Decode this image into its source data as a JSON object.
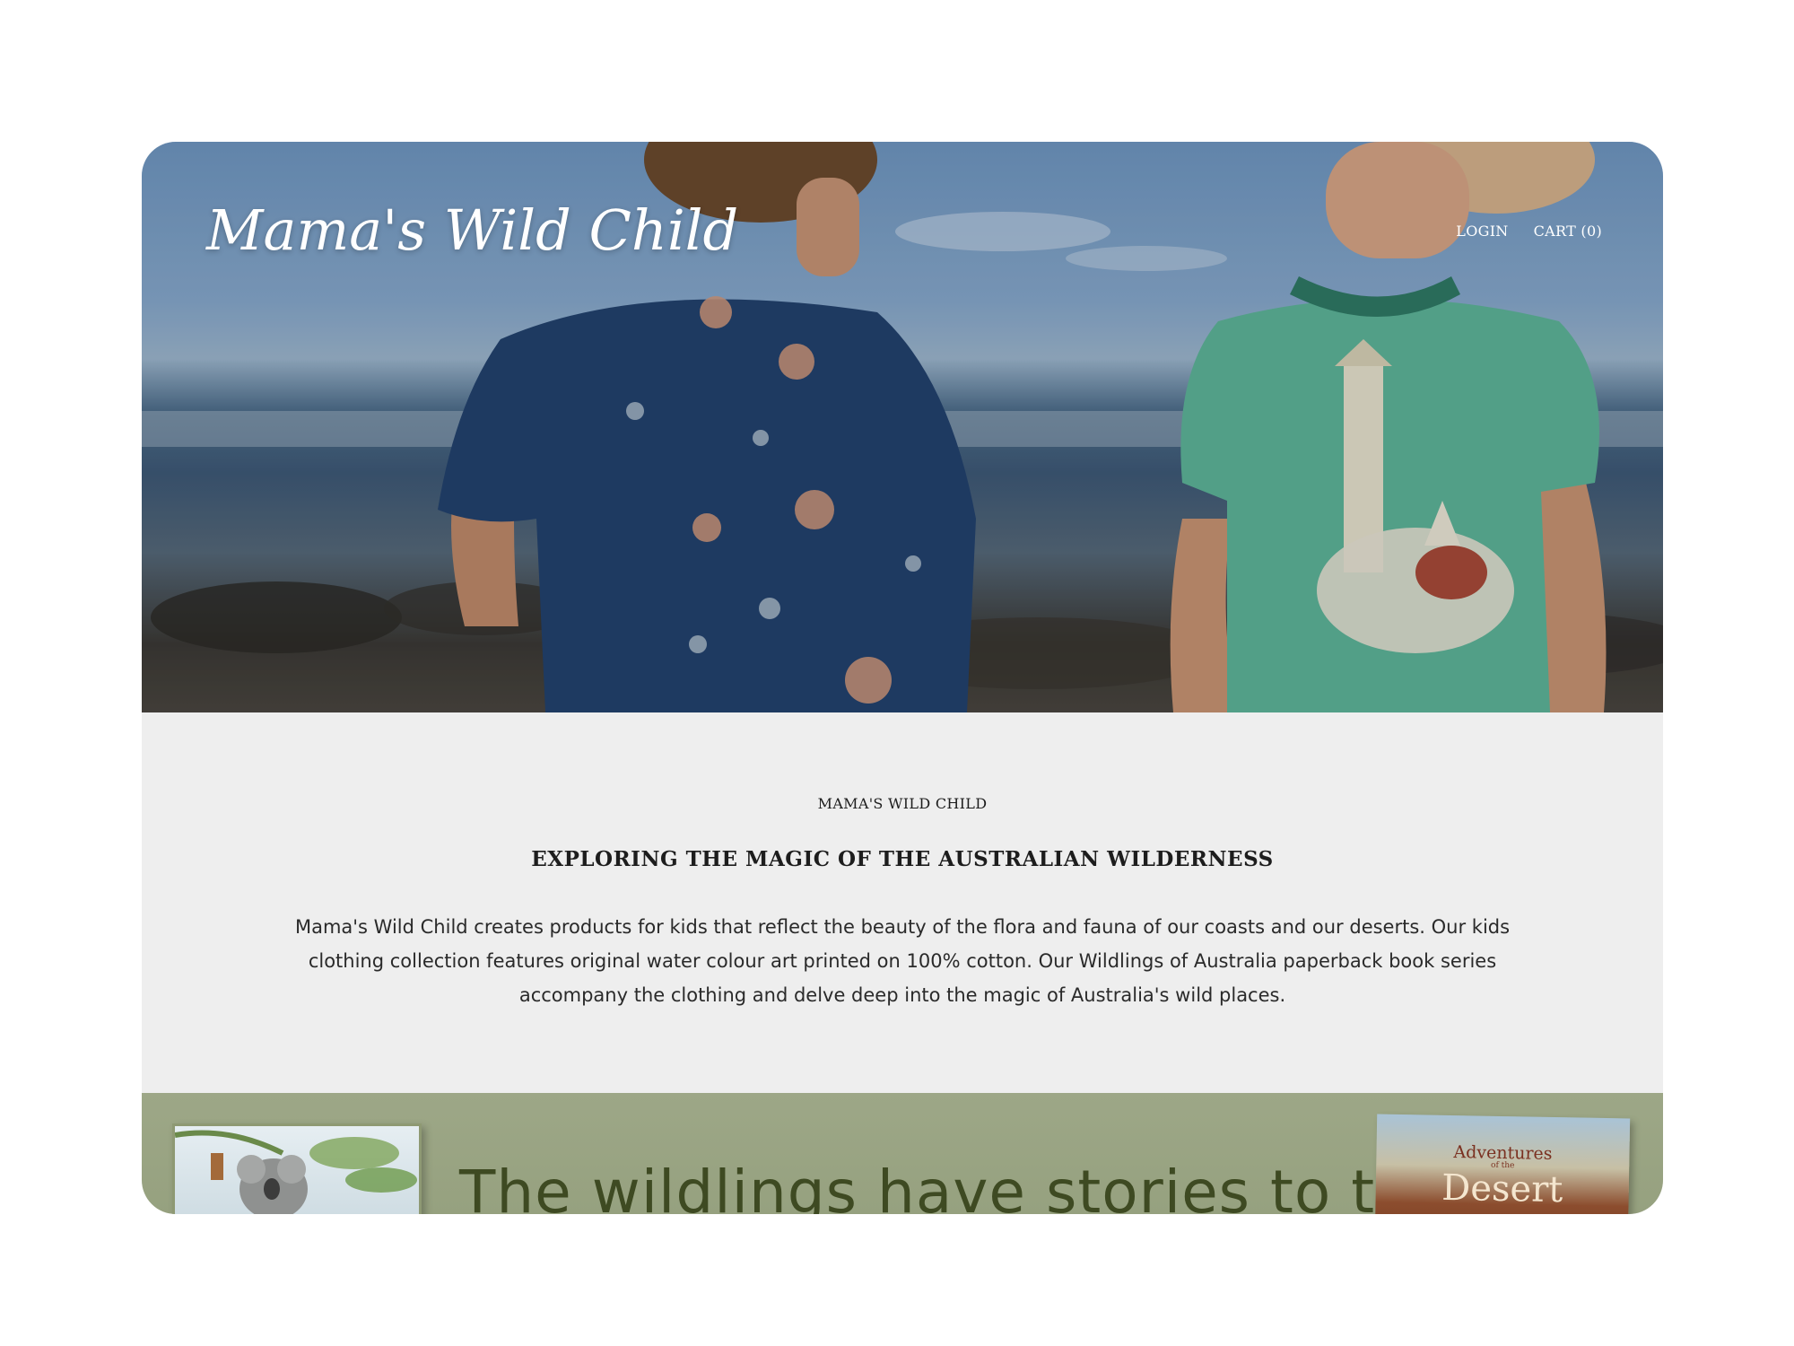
{
  "header": {
    "logo": "Mama's Wild Child",
    "nav": {
      "login": "LOGIN",
      "cart": "CART (0)"
    }
  },
  "intro": {
    "eyebrow": "MAMA'S WILD CHILD",
    "headline": "EXPLORING THE MAGIC OF THE AUSTRALIAN WILDERNESS",
    "body": "Mama's Wild Child creates products for kids that reflect the beauty of the flora and fauna of our coasts and our deserts. Our kids clothing collection features original water colour art printed on 100% cotton. Our Wildlings of Australia paperback book series accompany the clothing and delve deep into the magic of Australia's wild places."
  },
  "banner": {
    "tagline": "The wildlings have stories to tell.",
    "right_book": {
      "title_line1": "Adventures",
      "title_line2": "of the",
      "title_line3": "Desert"
    }
  },
  "colors": {
    "page_bg": "#ffffff",
    "intro_bg": "#eeeeee",
    "banner_bg": "#9da787",
    "tagline": "#3e4a22"
  }
}
